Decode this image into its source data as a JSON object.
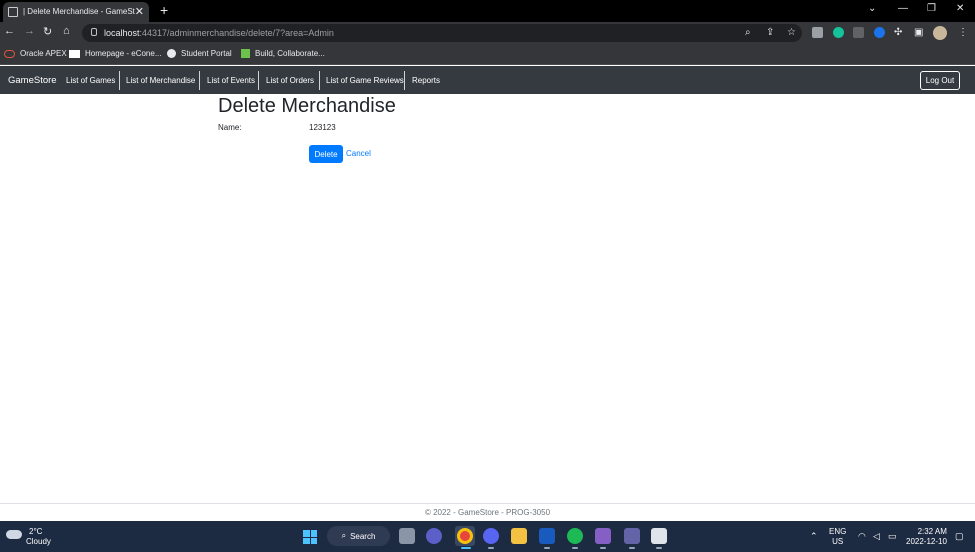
{
  "browser": {
    "tab_title": "| Delete Merchandise - GameStore",
    "url_host": "localhost",
    "url_rest": ":44317/adminmerchandise/delete/7?area=Admin",
    "bookmarks": [
      "Oracle APEX",
      "Homepage - eCone...",
      "Student Portal",
      "Build, Collaborate..."
    ]
  },
  "navbar": {
    "brand": "GameStore",
    "links": [
      "List of Games",
      "List of Merchandise",
      "List of Events",
      "List of Orders",
      "List of Game Reviews",
      "Reports"
    ],
    "logout_label": "Log Out"
  },
  "page": {
    "heading": "Delete Merchandise",
    "name_label": "Name:",
    "name_value": "123123",
    "delete_label": "Delete",
    "cancel_label": "Cancel",
    "footer": "© 2022 - GameStore - PROG-3050"
  },
  "taskbar": {
    "temperature": "2°C",
    "condition": "Cloudy",
    "search_label": "Search",
    "lang_top": "ENG",
    "lang_bottom": "US",
    "time": "2:32 AM",
    "date": "2022-12-10"
  },
  "colors": {
    "navbar_bg": "#343a40",
    "primary": "#007bff",
    "taskbar_bg": "#1c2a42"
  }
}
